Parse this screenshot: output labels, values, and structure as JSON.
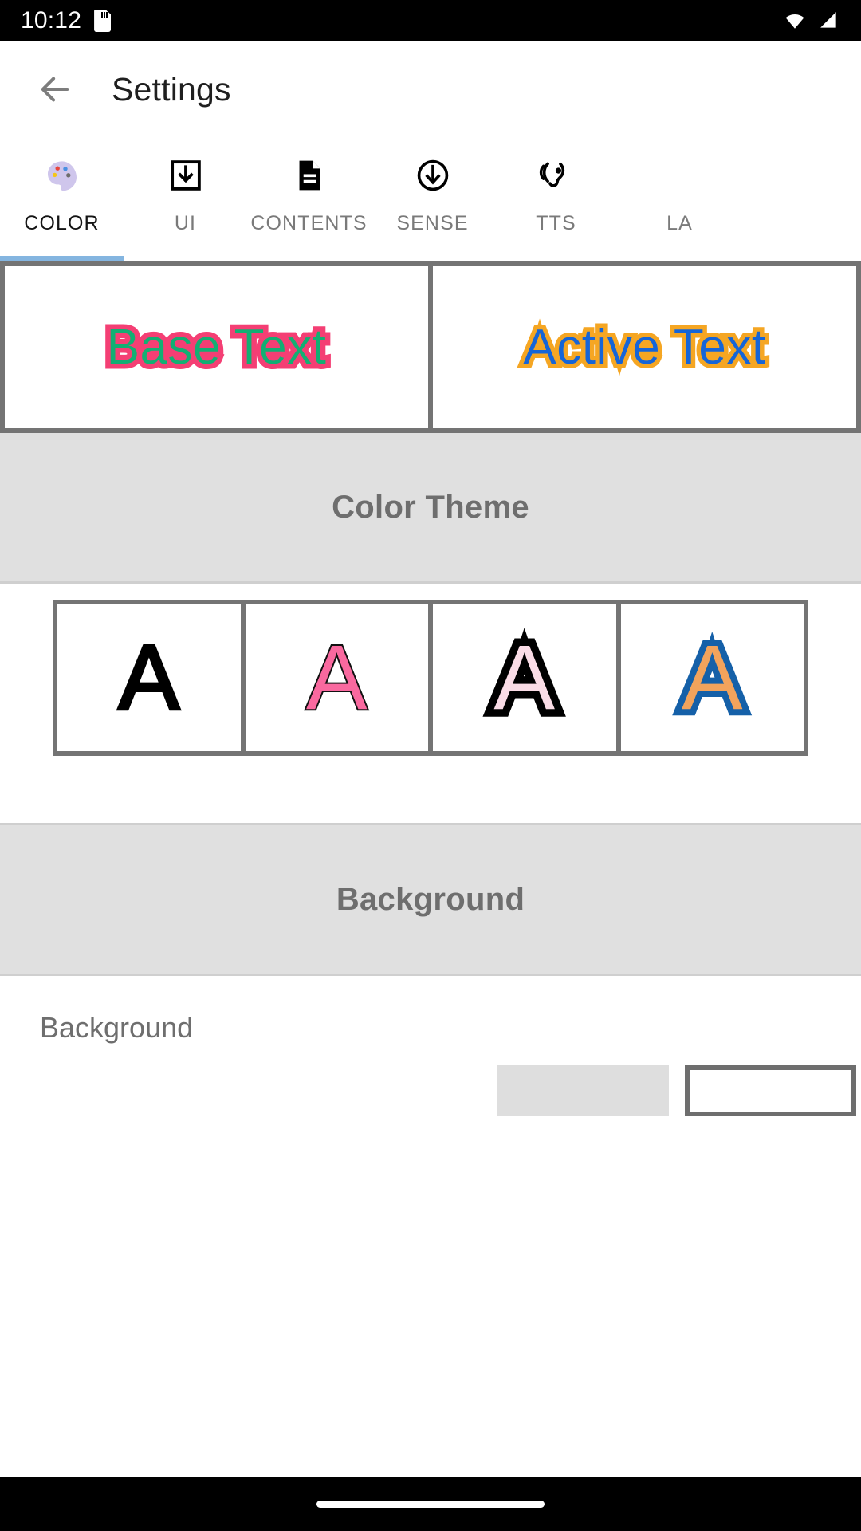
{
  "status_bar": {
    "time": "10:12",
    "sd_icon": "sd-card-icon",
    "wifi_icon": "wifi-icon",
    "signal_icon": "cell-signal-icon"
  },
  "app_bar": {
    "back_icon": "back-arrow-icon",
    "title": "Settings"
  },
  "tabs": {
    "active_index": 0,
    "items": [
      {
        "label": "COLOR",
        "icon": "palette-icon"
      },
      {
        "label": "UI",
        "icon": "box-download-icon"
      },
      {
        "label": "CONTENTS",
        "icon": "document-icon"
      },
      {
        "label": "SENSE",
        "icon": "circle-download-icon"
      },
      {
        "label": "TTS",
        "icon": "hearing-ear-icon"
      },
      {
        "label": "LA",
        "icon": "language-icon"
      }
    ]
  },
  "preview": {
    "base": {
      "text": "Base Text",
      "fill_color": "#12AF73",
      "stroke_color": "#F43F74"
    },
    "active": {
      "text": "Active Text",
      "fill_color": "#1565D8",
      "stroke_color": "#F5A623"
    }
  },
  "color_theme_section": {
    "header": "Color Theme",
    "swatches": [
      {
        "letter": "A",
        "fill_color": "#000000",
        "stroke_color": "#000000"
      },
      {
        "letter": "A",
        "fill_color": "#F9699F",
        "stroke_color": "#111111"
      },
      {
        "letter": "A",
        "fill_color": "#FADCE6",
        "stroke_color": "#000000"
      },
      {
        "letter": "A",
        "fill_color": "#F2A35C",
        "stroke_color": "#1560A8"
      }
    ]
  },
  "background_section": {
    "header": "Background",
    "row_label": "Background"
  },
  "nav_bar": {
    "home_indicator": "home-pill"
  }
}
